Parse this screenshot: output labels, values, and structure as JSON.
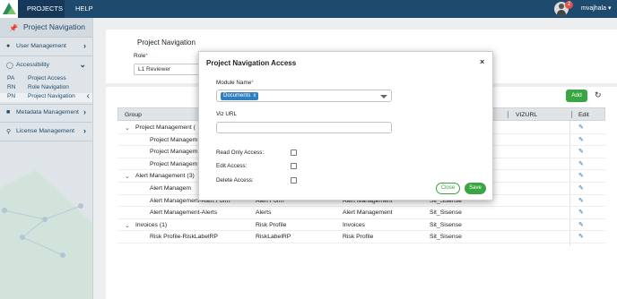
{
  "topbar": {
    "projects_label": "PROJECTS",
    "help_label": "HELP",
    "notification_count": "2",
    "username": "mvajhala ▾"
  },
  "sidebar": {
    "title": "Project Navigation",
    "items": [
      {
        "label": "User Management",
        "icon": "user-icon"
      },
      {
        "label": "Accessibility",
        "icon": "accessibility-icon"
      },
      {
        "label": "Metadata Management",
        "icon": "metadata-icon"
      },
      {
        "label": "License Management",
        "icon": "license-icon"
      }
    ],
    "subitems": [
      {
        "abbr": "PA",
        "label": "Project Access"
      },
      {
        "abbr": "RN",
        "label": "Role Navigation"
      },
      {
        "abbr": "PN",
        "label": "Project Navigation"
      }
    ]
  },
  "page": {
    "title": "Project Navigation",
    "role_label": "Role",
    "role_required": "*",
    "role_value": "L1 Reviewer",
    "add_label": "Add"
  },
  "table": {
    "headers": {
      "group": "Group",
      "vizurl": "VIZURL",
      "edit": "Edit"
    },
    "rows": [
      {
        "toggle": "⌄",
        "c1": "Project Management (",
        "c2": "",
        "c3": "",
        "c4": ""
      },
      {
        "toggle": "",
        "c1": "Project Managem",
        "c2": "",
        "c3": "",
        "c4": ""
      },
      {
        "toggle": "",
        "c1": "Project Managem",
        "c2": "",
        "c3": "",
        "c4": ""
      },
      {
        "toggle": "",
        "c1": "Project Managem",
        "c2": "",
        "c3": "",
        "c4": ""
      },
      {
        "toggle": "⌄",
        "c1": "Alert Management (3)",
        "c2": "",
        "c3": "",
        "c4": ""
      },
      {
        "toggle": "",
        "c1": "Alert Managem",
        "c2": "",
        "c3": "",
        "c4": ""
      },
      {
        "toggle": "",
        "c1": "Alert Management-Alert Form",
        "c2": "Alert Form",
        "c3": "Alert Management",
        "c4": "Sit_Sisense"
      },
      {
        "toggle": "",
        "c1": "Alert Management-Alerts",
        "c2": "Alerts",
        "c3": "Alert Management",
        "c4": "Sit_Sisense"
      },
      {
        "toggle": "⌄",
        "c1": "Invoices (1)",
        "c2": "Risk Profile",
        "c3": "Invoices",
        "c4": "Sit_Sisense"
      },
      {
        "toggle": "",
        "c1": "Risk Profile-RiskLabelRP",
        "c2": "RiskLabelRP",
        "c3": "Risk Profile",
        "c4": "Sit_Sisense"
      }
    ]
  },
  "modal": {
    "title": "Project Navigation Access",
    "close_symbol": "×",
    "module_label": "Module Name",
    "module_required": "*",
    "module_chip": "Documents",
    "chip_remove": "x",
    "viz_label": "Viz URL",
    "viz_value": "",
    "read_only_label": "Read Only Access:",
    "edit_label": "Edit Access:",
    "delete_label": "Delete Access:",
    "close_button": "Close",
    "save_button": "Save"
  },
  "colors": {
    "topbar": "#1e4a6e",
    "accent_green": "#3aa543",
    "chip_blue": "#2f7fc1"
  }
}
